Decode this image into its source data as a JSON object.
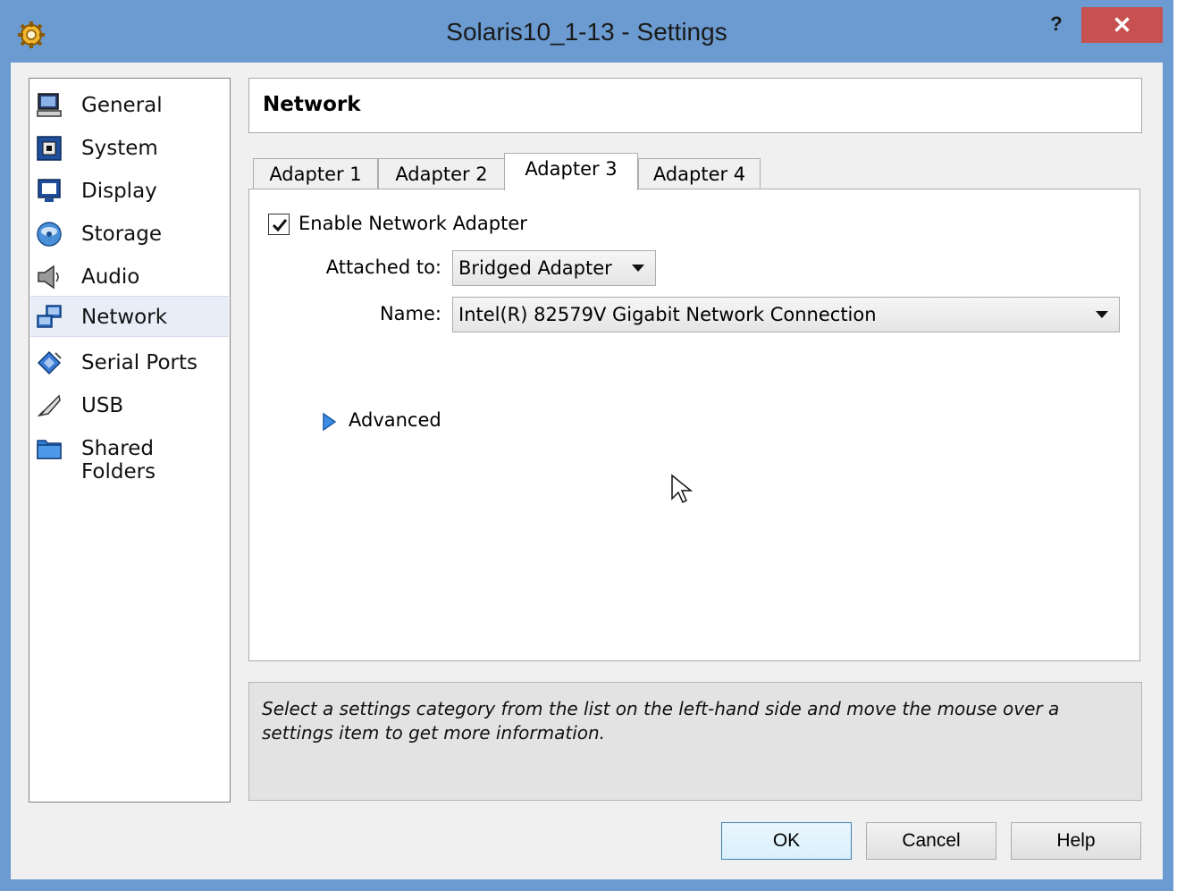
{
  "window": {
    "title": "Solaris10_1-13 - Settings",
    "help_label": "?",
    "close_label": "✕"
  },
  "sidebar": {
    "items": [
      {
        "label": "General",
        "icon": "general-monitor-icon"
      },
      {
        "label": "System",
        "icon": "system-chip-icon"
      },
      {
        "label": "Display",
        "icon": "display-monitor-icon"
      },
      {
        "label": "Storage",
        "icon": "storage-disc-icon"
      },
      {
        "label": "Audio",
        "icon": "audio-speaker-icon"
      },
      {
        "label": "Network",
        "icon": "network-icon",
        "selected": true
      },
      {
        "label": "Serial Ports",
        "icon": "serial-ports-icon"
      },
      {
        "label": "USB",
        "icon": "usb-icon"
      },
      {
        "label": "Shared Folders",
        "icon": "shared-folder-icon"
      }
    ]
  },
  "header": {
    "title": "Network"
  },
  "tabs": [
    {
      "label": "Adapter 1",
      "active": false
    },
    {
      "label": "Adapter 2",
      "active": false
    },
    {
      "label": "Adapter 3",
      "active": true
    },
    {
      "label": "Adapter 4",
      "active": false
    }
  ],
  "adapter": {
    "enable_label": "Enable Network Adapter",
    "enabled": true,
    "attached_label": "Attached to:",
    "attached_value": "Bridged Adapter",
    "name_label": "Name:",
    "name_value": "Intel(R) 82579V Gigabit Network Connection",
    "advanced_label": "Advanced"
  },
  "info": {
    "text": "Select a settings category from the list on the left-hand side and move the mouse over a settings item to get more information."
  },
  "buttons": {
    "ok": "OK",
    "cancel": "Cancel",
    "help": "Help"
  },
  "colors": {
    "titlebar": "#6b9bd0",
    "close": "#c75050",
    "selected_item": "#e8eef8"
  }
}
